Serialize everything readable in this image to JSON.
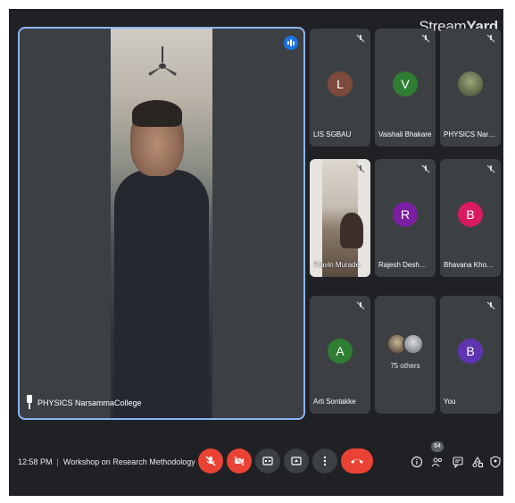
{
  "watermark": {
    "brand_light": "Stream",
    "brand_bold": "Yard"
  },
  "main_speaker": {
    "name": "PHYSICS NarsammaCollege"
  },
  "participants": [
    {
      "name": "LIS SGBAU",
      "initial": "L",
      "color": "#7b4a3a"
    },
    {
      "name": "Vaishali Bhakare",
      "initial": "V",
      "color": "#2e7d32"
    },
    {
      "name": "PHYSICS Narsam...",
      "initial": "",
      "color": "#6b7b52"
    },
    {
      "name": "Pravin Murade",
      "initial": "",
      "color": ""
    },
    {
      "name": "Rajesh Deshmukh",
      "initial": "R",
      "color": "#7b1fa2"
    },
    {
      "name": "Bhavana Khobrag...",
      "initial": "B",
      "color": "#d81b60"
    },
    {
      "name": "Arti Sontakke",
      "initial": "A",
      "color": "#2e7d32"
    },
    {
      "name": "75 others",
      "initial": "",
      "color": ""
    },
    {
      "name": "You",
      "initial": "B",
      "color": "#5e35b1"
    }
  ],
  "bottom_bar": {
    "time": "12:58 PM",
    "separator": "|",
    "meeting_title": "Workshop on Research Methodology",
    "participant_count": "84"
  },
  "colors": {
    "background": "#202124",
    "tile": "#3c4043",
    "active_border": "#8ab4f8",
    "danger": "#ea4335"
  }
}
